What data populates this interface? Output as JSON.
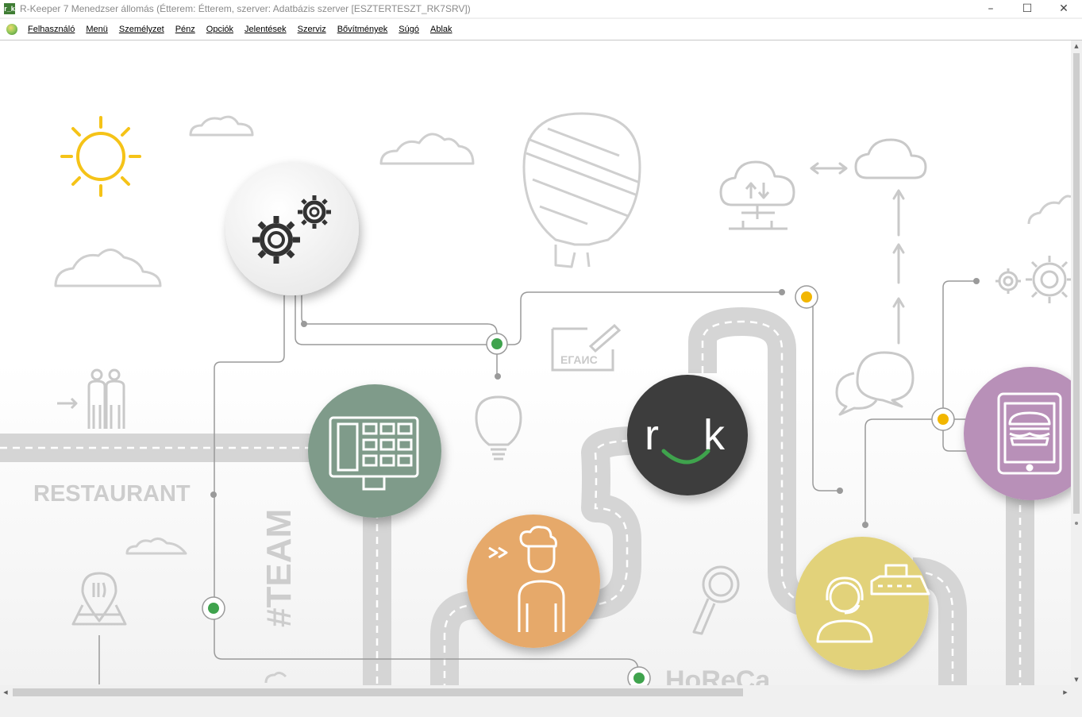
{
  "window": {
    "title": "R-Keeper 7 Menedzser állomás (Étterem: Étterem, szerver: Adatbázis szerver [ESZTERTESZT_RK7SRV])",
    "logo_text": "r_k",
    "controls": {
      "minimize": "–",
      "maximize": "☐",
      "close": "✕"
    }
  },
  "menu": {
    "items": [
      "Felhasználó",
      "Menü",
      "Személyzet",
      "Pénz",
      "Opciók",
      "Jelentések",
      "Szerviz",
      "Bővítmények",
      "Súgó",
      "Ablak"
    ]
  },
  "background": {
    "labels": {
      "restaurant": "RESTAURANT",
      "team": "#TEAM",
      "horeca": "HoReCa",
      "egais": "ЕГАИС"
    },
    "logo": {
      "left": "r",
      "right": "k"
    }
  },
  "colors": {
    "road": "#d5d5d5",
    "line": "#9a9a9a",
    "dot_green": "#3fa34d",
    "dot_yellow": "#f2b600",
    "sun": "#f5c318",
    "pos_circle": "#7f9b8a",
    "chef_circle": "#e6a96a",
    "logo_circle": "#3c3c3c",
    "support_circle": "#e2d27a",
    "tablet_circle": "#b890b8",
    "settings_circle": "#f7f7f7"
  },
  "icons": [
    "settings-icon",
    "pos-terminal-icon",
    "chef-icon",
    "rk-logo-icon",
    "support-operator-icon",
    "tablet-burger-icon",
    "sun-icon",
    "cloud-icon",
    "balloon-icon",
    "cloud-upload-icon",
    "lightbulb-icon",
    "chat-icon",
    "gears-icon",
    "people-icon",
    "map-pin-icon",
    "search-icon"
  ]
}
